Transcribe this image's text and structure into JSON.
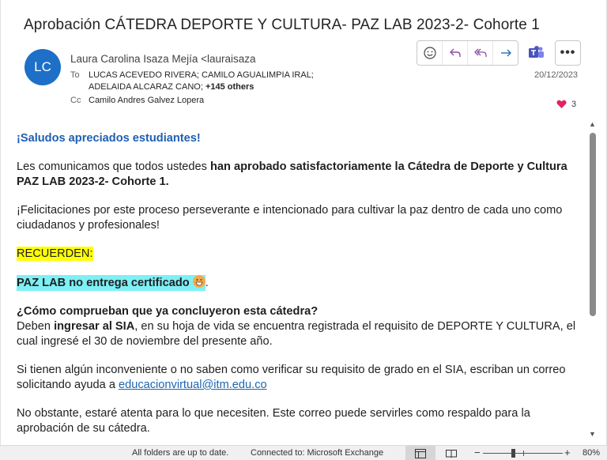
{
  "email": {
    "subject": "Aprobación CÁTEDRA DEPORTE Y CULTURA- PAZ LAB 2023-2- Cohorte 1",
    "avatar_initials": "LC",
    "from": "Laura Carolina Isaza Mejía <lauraisaza",
    "to_label": "To",
    "to_line1": "LUCAS ACEVEDO RIVERA; CAMILO AGUALIMPIA IRAL;",
    "to_line2": "ADELAIDA ALCARAZ CANO;",
    "to_more": "+145 others",
    "cc_label": "Cc",
    "cc": "Camilo Andres Galvez Lopera",
    "date": "20/12/2023",
    "reaction_count": "3",
    "accent_color": "#1d6fc7"
  },
  "actions": {
    "icons": [
      "emoji-icon",
      "reply-icon",
      "reply-all-icon",
      "forward-icon",
      "teams-icon",
      "more-icon"
    ]
  },
  "body": {
    "greeting": "¡Saludos apreciados estudiantes!",
    "p1_start": "Les comunicamos que todos ustedes ",
    "p1_bold": "han aprobado satisfactoriamente la Cátedra de Deporte y Cultura PAZ LAB 2023-2- Cohorte 1.",
    "p2": "¡Felicitaciones por este proceso perseverante e intencionado para cultivar la paz dentro de cada uno como ciudadanos y profesionales!",
    "recuerden": "RECUERDEN:",
    "no_cert": "PAZ LAB no entrega certificado ",
    "no_cert_end": ".",
    "question": "¿Cómo comprueban que ya concluyeron esta cátedra?",
    "p3_start": "Deben ",
    "p3_bold": "ingresar al SIA",
    "p3_end": ", en su hoja de vida se encuentra registrada el requisito de DEPORTE Y CULTURA, el cual ingresé el 30 de noviembre del presente año.",
    "p4_start": "Si tienen algún inconveniente o no saben como verificar su requisito de grado en el SIA, escriban un correo solicitando ayuda a ",
    "p4_link": "educacionvirtual@itm.edu.co",
    "p5": "No obstante, estaré atenta para lo que necesiten.  Este correo puede servirles como respaldo para la aprobación de su cátedra."
  },
  "statusbar": {
    "sync": "All folders are up to date.",
    "connection": "Connected to: Microsoft Exchange",
    "zoom": "80%"
  }
}
